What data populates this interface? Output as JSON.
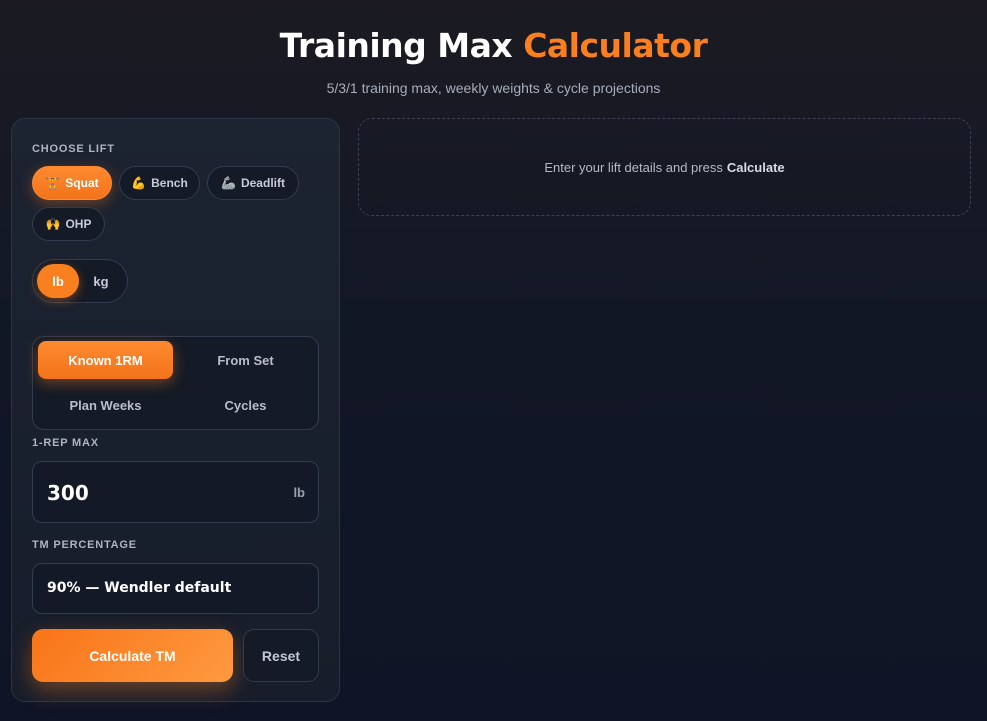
{
  "header": {
    "title_main": "Training Max",
    "title_accent": "Calculator",
    "subtitle": "5/3/1 training max, weekly weights & cycle projections"
  },
  "lift": {
    "label": "CHOOSE LIFT",
    "options": [
      {
        "emoji": "🏋",
        "label": "Squat",
        "active": true
      },
      {
        "emoji": "💪",
        "label": "Bench",
        "active": false
      },
      {
        "emoji": "🦾",
        "label": "Deadlift",
        "active": false
      },
      {
        "emoji": "🙌",
        "label": "OHP",
        "active": false
      }
    ]
  },
  "units": {
    "options": [
      "lb",
      "kg"
    ],
    "selected": "lb"
  },
  "modes": {
    "options": [
      "Known 1RM",
      "From Set",
      "Plan Weeks",
      "Cycles"
    ],
    "selected": "Known 1RM"
  },
  "rm": {
    "label": "1-REP MAX",
    "value": "300",
    "unit": "lb"
  },
  "tm": {
    "label": "TM PERCENTAGE",
    "selected": "90% — Wendler default"
  },
  "actions": {
    "calculate": "Calculate TM",
    "reset": "Reset"
  },
  "results": {
    "prompt": "Enter your lift details and press",
    "prompt_bold": "Calculate"
  },
  "colors": {
    "accent": "#f97f1f",
    "background": "#121726",
    "panel": "#1c2331"
  }
}
